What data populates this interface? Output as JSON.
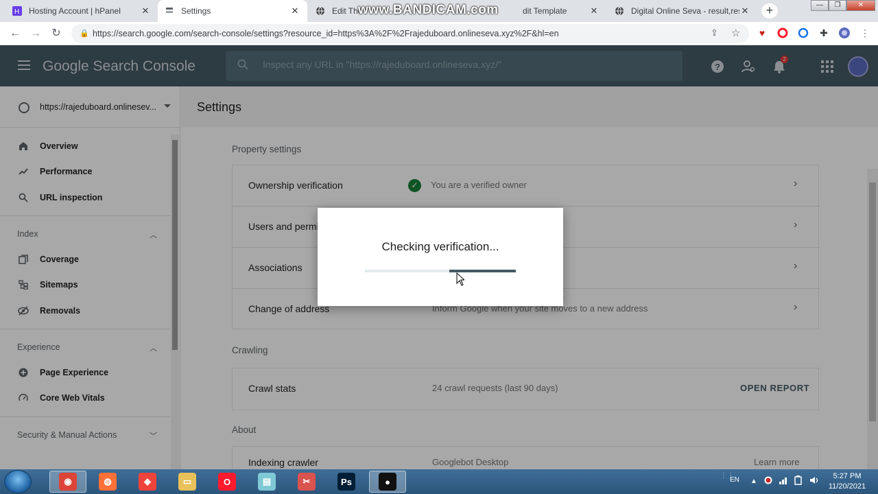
{
  "browser": {
    "tabs": [
      {
        "title": "Hosting Account | hPanel",
        "active": false,
        "favicon": "hpanel-icon",
        "favicon_color": "#673de6"
      },
      {
        "title": "Settings",
        "active": true,
        "favicon": "search-console-icon",
        "favicon_color": "#5f6368"
      },
      {
        "title": "Edit The",
        "active": false,
        "favicon": "globe-icon",
        "favicon_color": "#3c4043"
      },
      {
        "title": "dit Template",
        "active": false,
        "favicon": "none",
        "favicon_color": "#3c4043"
      },
      {
        "title": "Digital Online Seva - result,resu",
        "active": false,
        "favicon": "globe-icon",
        "favicon_color": "#3c4043"
      }
    ],
    "url": "https://search.google.com/search-console/settings?resource_id=https%3A%2F%2Frajeduboard.onlineseva.xyz%2F&hl=en",
    "watermark": "www.BANDICAM.com"
  },
  "app": {
    "brand": "Google Search Console",
    "inspect_placeholder": "Inspect any URL in \"https://rajeduboard.onlineseva.xyz/\"",
    "notification_count": "2",
    "accent_color": "#455a64"
  },
  "sidebar": {
    "property": "https://rajeduboard.onlinesev...",
    "items_top": [
      {
        "label": "Overview",
        "icon": "home-icon"
      },
      {
        "label": "Performance",
        "icon": "trending-up-icon"
      },
      {
        "label": "URL inspection",
        "icon": "search-icon"
      }
    ],
    "index_label": "Index",
    "index_items": [
      {
        "label": "Coverage",
        "icon": "coverage-icon"
      },
      {
        "label": "Sitemaps",
        "icon": "sitemap-icon"
      },
      {
        "label": "Removals",
        "icon": "removals-icon"
      }
    ],
    "experience_label": "Experience",
    "experience_items": [
      {
        "label": "Page Experience",
        "icon": "plus-circle-icon"
      },
      {
        "label": "Core Web Vitals",
        "icon": "gauge-icon"
      }
    ],
    "security_label": "Security & Manual Actions"
  },
  "main": {
    "title": "Settings",
    "property_settings_label": "Property settings",
    "rows": [
      {
        "label": "Ownership verification",
        "value": "You are a verified owner"
      },
      {
        "label": "Users and permi",
        "value": ""
      },
      {
        "label": "Associations",
        "value": ""
      },
      {
        "label": "Change of address",
        "value": "Inform Google when your site moves to a new address"
      }
    ],
    "crawling_label": "Crawling",
    "crawl": {
      "label": "Crawl stats",
      "value": "24 crawl requests (last 90 days)",
      "action": "OPEN REPORT"
    },
    "about_label": "About",
    "about": {
      "label": "Indexing crawler",
      "value": "Googlebot Desktop",
      "action": "Learn more"
    }
  },
  "dialog": {
    "message": "Checking verification...",
    "progress_start": 0.56,
    "progress_end": 1.0
  },
  "taskbar": {
    "language": "EN",
    "time": "5:27 PM",
    "date": "11/20/2021",
    "apps": [
      {
        "name": "chrome-icon",
        "color": "#db4437",
        "active": true
      },
      {
        "name": "firefox-icon",
        "color": "#ff7139",
        "active": false
      },
      {
        "name": "anydesk-icon",
        "color": "#ef443b",
        "active": false
      },
      {
        "name": "file-explorer-icon",
        "color": "#e8c15a",
        "active": false
      },
      {
        "name": "opera-icon",
        "color": "#ff1b2d",
        "active": false
      },
      {
        "name": "notepad-icon",
        "color": "#7fc8d6",
        "active": false
      },
      {
        "name": "snipping-tool-icon",
        "color": "#d9534f",
        "active": false
      },
      {
        "name": "photoshop-icon",
        "color": "#001e36",
        "active": false
      },
      {
        "name": "bandicam-icon",
        "color": "#111111",
        "active": true
      }
    ]
  }
}
